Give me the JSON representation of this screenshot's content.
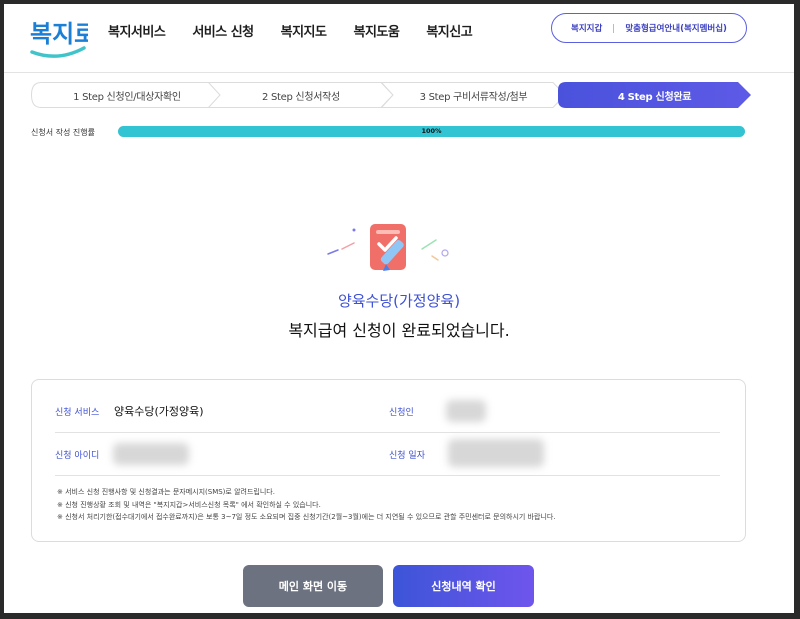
{
  "header": {
    "logo_text": "복지로",
    "gnb": [
      "복지서비스",
      "서비스 신청",
      "복지지도",
      "복지도움",
      "복지신고"
    ],
    "util_links": [
      "복지지갑",
      "맞춤형급여안내(복지멤버십)"
    ]
  },
  "steps": [
    {
      "label": "1 Step 신청인/대상자확인",
      "active": false
    },
    {
      "label": "2 Step 신청서작성",
      "active": false
    },
    {
      "label": "3 Step 구비서류작성/첨부",
      "active": false
    },
    {
      "label": "4 Step 신청완료",
      "active": true
    }
  ],
  "progress": {
    "label": "신청서 작성 진행률",
    "percent": 100,
    "percent_text": "100%"
  },
  "result": {
    "service_name": "양육수당(가정양육)",
    "message": "복지급여 신청이 완료되었습니다."
  },
  "details": {
    "service_label": "신청 서비스",
    "service_value": "양육수당(가정양육)",
    "applicant_label": "신청인",
    "id_label": "신청 아이디",
    "date_label": "신청 일자"
  },
  "notes": [
    "※ 서비스 신청 진행사항 및 신청결과는 문자메시지(SMS)로 알려드립니다.",
    "※ 신청 진행상황 조회 및 내역은 \"복지지갑>서비스신청 목록\" 에서 확인하실 수 있습니다.",
    "※ 신청서 처리기한(접수대기에서 접수완료까지)은 보통 3~7일 정도 소요되며 집중 신청기간(2월~3월)에는 더 지연될 수 있으므로 관할 주민센터로 문의하시기 바랍니다."
  ],
  "buttons": {
    "main": "메인 화면 이동",
    "history": "신청내역 확인"
  },
  "colors": {
    "accent": "#3e51d4",
    "progress": "#33c4d4",
    "active_step": "#4f56e0",
    "secondary_button": "#6c7280"
  }
}
